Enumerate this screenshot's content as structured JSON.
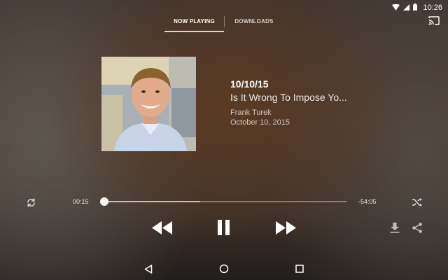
{
  "status_bar": {
    "time": "10:26",
    "icons": [
      "wifi-icon",
      "cell-signal-icon",
      "battery-icon"
    ]
  },
  "tabs": [
    {
      "label": "NOW PLAYING",
      "active": true
    },
    {
      "label": "DOWNLOADS",
      "active": false
    }
  ],
  "episode": {
    "date": "10/10/15",
    "title": "Is It Wrong To Impose Yo...",
    "author": "Frank Turek",
    "published": "October 10, 2015"
  },
  "playback": {
    "elapsed": "00:15",
    "remaining": "-54:05",
    "progress_fraction": 0.005,
    "buffered_fraction": 0.4,
    "state": "playing"
  },
  "controls": [
    "repeat-icon",
    "rewind-icon",
    "pause-icon",
    "fast-forward-icon",
    "shuffle-icon",
    "download-icon",
    "share-icon",
    "cast-icon"
  ],
  "colors": {
    "accent": "#ffffff",
    "track": "#8a807a"
  },
  "nav_bar": [
    "back-icon",
    "home-icon",
    "recents-icon"
  ]
}
